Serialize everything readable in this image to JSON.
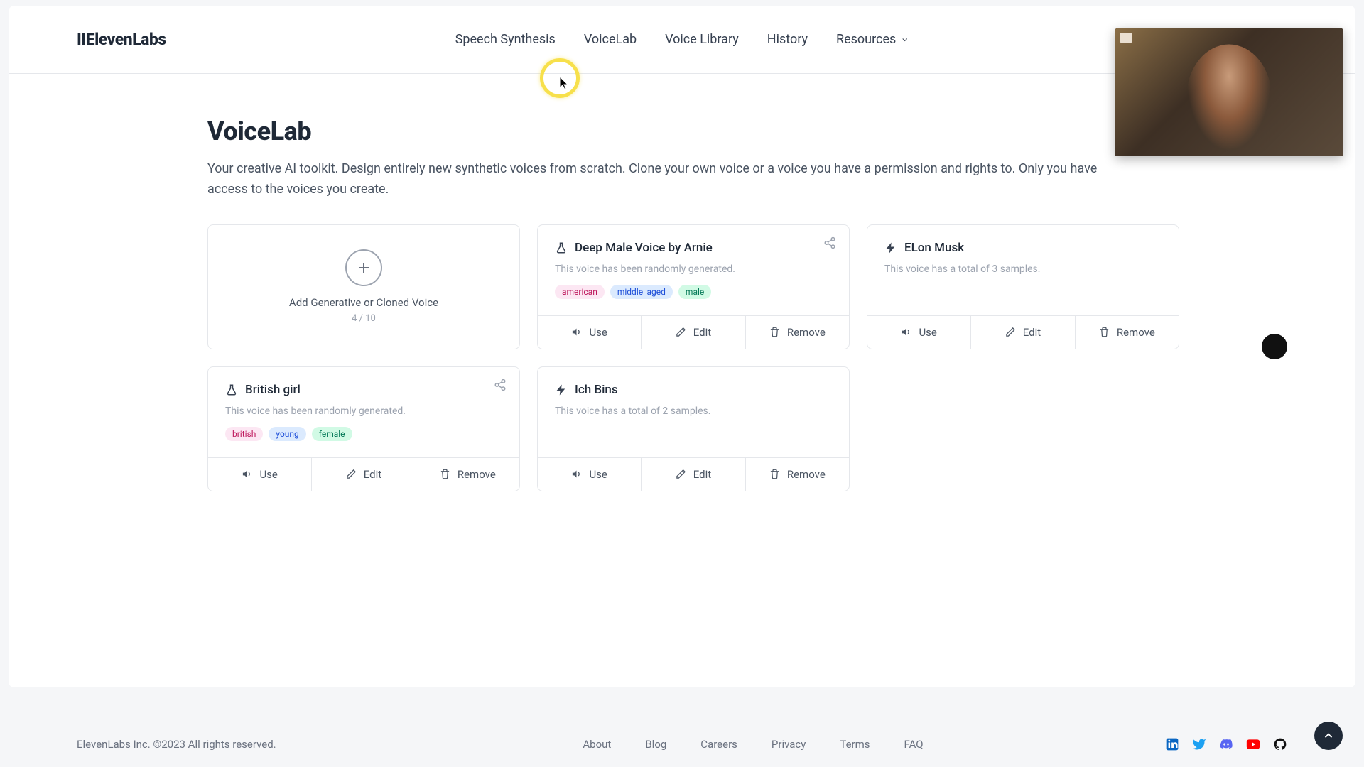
{
  "logo": "IIElevenLabs",
  "nav": {
    "items": [
      "Speech Synthesis",
      "VoiceLab",
      "Voice Library",
      "History",
      "Resources"
    ]
  },
  "page": {
    "title": "VoiceLab",
    "description": "Your creative AI toolkit. Design entirely new synthetic voices from scratch. Clone your own voice or a voice you have a permission and rights to. Only you have access to the voices you create."
  },
  "add_card": {
    "label": "Add Generative or Cloned Voice",
    "count": "4 / 10"
  },
  "voices": [
    {
      "name": "Deep Male Voice by Arnie",
      "icon": "flask",
      "desc": "This voice has been randomly generated.",
      "tags": [
        {
          "text": "american",
          "cls": "tag-pink"
        },
        {
          "text": "middle_aged",
          "cls": "tag-blue"
        },
        {
          "text": "male",
          "cls": "tag-green"
        }
      ],
      "shareable": true
    },
    {
      "name": "ELon Musk",
      "icon": "bolt",
      "desc": "This voice has a total of 3 samples.",
      "tags": [],
      "shareable": false
    },
    {
      "name": "British girl",
      "icon": "flask",
      "desc": "This voice has been randomly generated.",
      "tags": [
        {
          "text": "british",
          "cls": "tag-pink"
        },
        {
          "text": "young",
          "cls": "tag-blue"
        },
        {
          "text": "female",
          "cls": "tag-green"
        }
      ],
      "shareable": true
    },
    {
      "name": "Ich Bins",
      "icon": "bolt",
      "desc": "This voice has a total of 2 samples.",
      "tags": [],
      "shareable": false
    }
  ],
  "actions": {
    "use": "Use",
    "edit": "Edit",
    "remove": "Remove"
  },
  "footer": {
    "copyright": "ElevenLabs Inc. ©2023 All rights reserved.",
    "links": [
      "About",
      "Blog",
      "Careers",
      "Privacy",
      "Terms",
      "FAQ"
    ]
  }
}
